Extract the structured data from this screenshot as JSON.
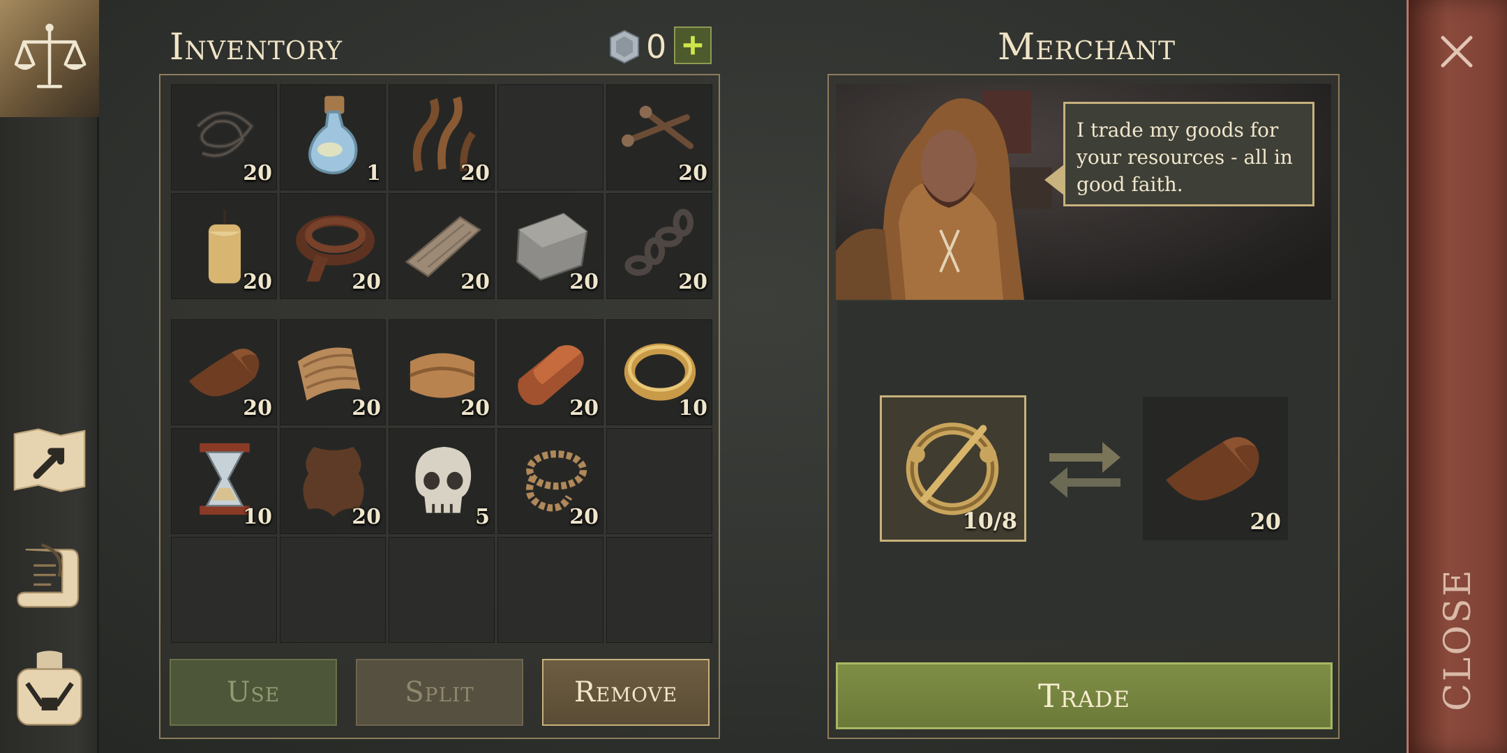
{
  "inventory": {
    "title": "Inventory",
    "currency_icon": "gem-icon",
    "currency_count": "0",
    "add_currency_icon": "plus-icon",
    "slots": [
      {
        "icon": "wire-icon",
        "count": "20"
      },
      {
        "icon": "potion-flask-icon",
        "count": "1"
      },
      {
        "icon": "fiber-strands-icon",
        "count": "20"
      },
      {
        "icon": "",
        "count": ""
      },
      {
        "icon": "nails-icon",
        "count": "20"
      },
      {
        "icon": "candle-icon",
        "count": "20"
      },
      {
        "icon": "leather-strap-icon",
        "count": "20"
      },
      {
        "icon": "wood-plank-icon",
        "count": "20"
      },
      {
        "icon": "stone-block-icon",
        "count": "20"
      },
      {
        "icon": "chain-icon",
        "count": "20"
      },
      {
        "icon": "leather-scroll-icon",
        "count": "20"
      },
      {
        "icon": "fabric-icon",
        "count": "20"
      },
      {
        "icon": "folded-cloth-icon",
        "count": "20"
      },
      {
        "icon": "copper-ingot-icon",
        "count": "20"
      },
      {
        "icon": "gold-ring-icon",
        "count": "10"
      },
      {
        "icon": "hourglass-icon",
        "count": "10"
      },
      {
        "icon": "hide-icon",
        "count": "20"
      },
      {
        "icon": "skull-icon",
        "count": "5"
      },
      {
        "icon": "rope-icon",
        "count": "20"
      },
      {
        "icon": "",
        "count": ""
      },
      {
        "icon": "",
        "count": ""
      },
      {
        "icon": "",
        "count": ""
      },
      {
        "icon": "",
        "count": ""
      },
      {
        "icon": "",
        "count": ""
      },
      {
        "icon": "",
        "count": ""
      }
    ],
    "buttons": {
      "use": "Use",
      "split": "Split",
      "remove": "Remove"
    }
  },
  "merchant": {
    "title": "Merchant",
    "speech": "I trade my goods for your resources - all in good faith.",
    "give_item": {
      "icon": "brooch-icon",
      "count": "10/8"
    },
    "get_item": {
      "icon": "leather-scroll-icon",
      "count": "20"
    },
    "trade_label": "Trade"
  },
  "nav": [
    "scales-icon",
    "map-icon",
    "scroll-quill-icon",
    "backpack-icon"
  ],
  "close_label": "CLOSE",
  "close_icon": "close-icon",
  "colors": {
    "accent_gold": "#c8b27d",
    "trade_green": "#7f8e45",
    "close_red": "#8a4a3c"
  }
}
